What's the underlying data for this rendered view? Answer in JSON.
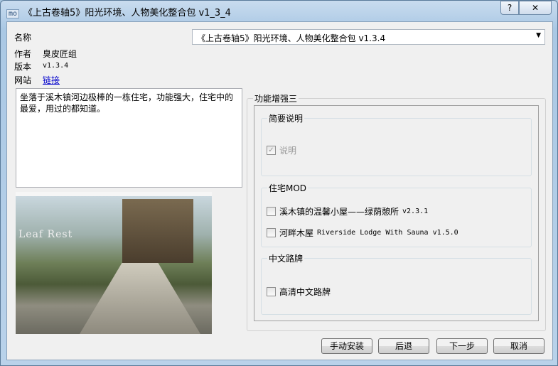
{
  "window": {
    "title": "《上古卷轴5》阳光环境、人物美化整合包 v1_3_4",
    "app_icon": "mo",
    "help_label": "?",
    "close_label": "✕"
  },
  "info": {
    "name_label": "名称",
    "name_value": "《上古卷轴5》阳光环境、人物美化整合包 v1.3.4",
    "author_label": "作者",
    "author_value": "臭皮匠组",
    "version_label": "版本",
    "version_value": "v1.3.4",
    "website_label": "网站",
    "website_link": "链接"
  },
  "description": "坐落于溪木镇河边极棒的一栋住宅，功能强大，住宅中的最爱，用过的都知道。",
  "preview": {
    "logo_text": "Leaf Rest"
  },
  "options": {
    "title": "功能增强三",
    "groups": [
      {
        "title": "简要说明",
        "items": [
          {
            "label": "说明",
            "checked": true,
            "disabled": true
          }
        ]
      },
      {
        "title": "住宅MOD",
        "items": [
          {
            "label": "溪木镇的温馨小屋——绿荫憩所",
            "version": "v2.3.1",
            "checked": false
          },
          {
            "label": "河畔木屋",
            "version": "Riverside Lodge With Sauna v1.5.0",
            "checked": false
          }
        ]
      },
      {
        "title": "中文路牌",
        "items": [
          {
            "label": "高清中文路牌",
            "checked": false
          }
        ]
      }
    ]
  },
  "buttons": {
    "manual": "手动安装",
    "back": "后退",
    "next": "下一步",
    "cancel": "取消"
  },
  "colors": {
    "link": "#0000cc",
    "window_frame": "#aac8e4"
  }
}
